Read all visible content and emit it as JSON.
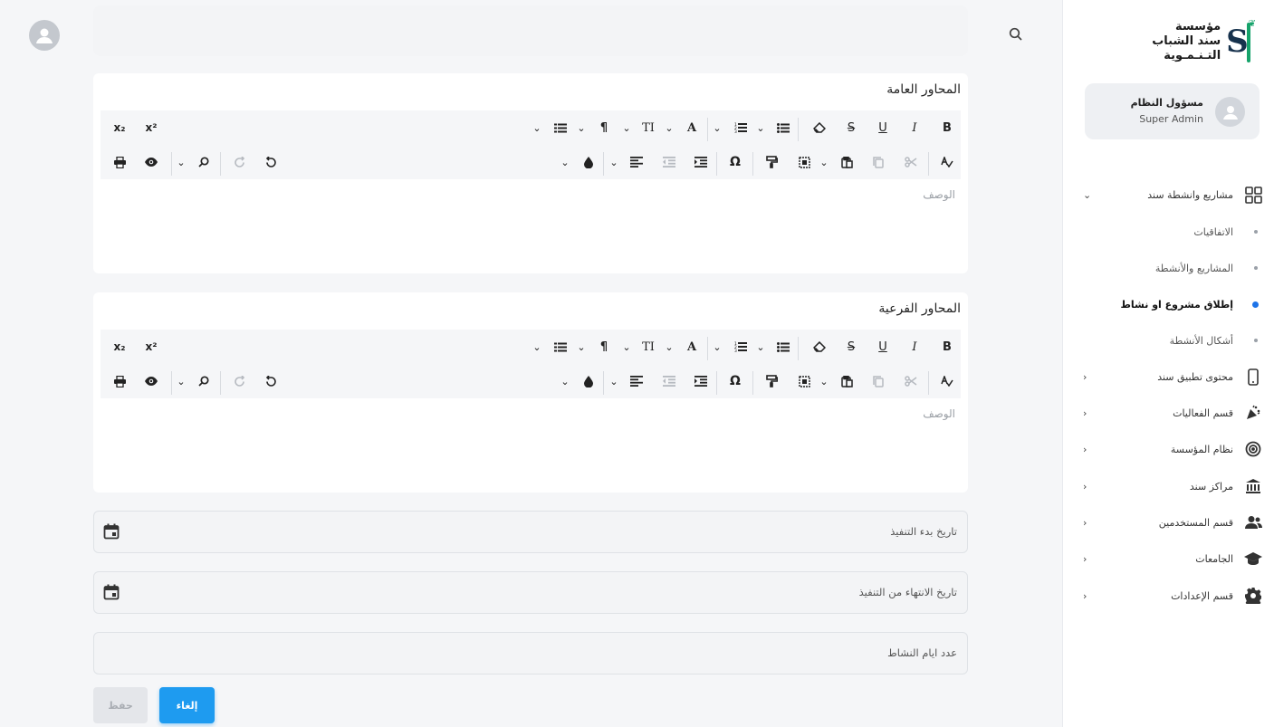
{
  "brand": {
    "line1": "مؤسسة",
    "line2": "سند الشباب",
    "line3": "التـنـمـوية"
  },
  "user": {
    "name": "مسؤول النظام",
    "role": "Super Admin"
  },
  "nav": {
    "projects_group": "مشاريع وانشطة سند",
    "sub_items": [
      "الاتفاقيات",
      "المشاريع والأنشطة",
      "إطلاق مشروع او نشاط",
      "أشكال الأنشطة"
    ],
    "items": [
      "محتوى تطبيق سند",
      "قسم الفعاليات",
      "نظام المؤسسة",
      "مراكز سند",
      "قسم المستخدمين",
      "الجامعات",
      "قسم الإعدادات"
    ]
  },
  "editors": {
    "general_title": "المحاور العامة",
    "sub_title": "المحاور الفرعية",
    "placeholder": "الوصف"
  },
  "toolbar": {
    "bold": "B",
    "italic": "I",
    "underline": "U",
    "strike": "S",
    "font": "A",
    "size": "TI",
    "para": "¶",
    "sub": "x₂",
    "sup": "x²",
    "omega": "Ω"
  },
  "form": {
    "start_date": "تاريخ بدء التنفيذ",
    "end_date": "تاريخ الانتهاء من التنفيذ",
    "days": "عدد ايام النشاط"
  },
  "buttons": {
    "save": "حفظ",
    "cancel": "إلغاء"
  },
  "colors": {
    "accent": "#1e9bf0",
    "active_dot": "#1e73e8",
    "brand_green": "#16a36b"
  }
}
